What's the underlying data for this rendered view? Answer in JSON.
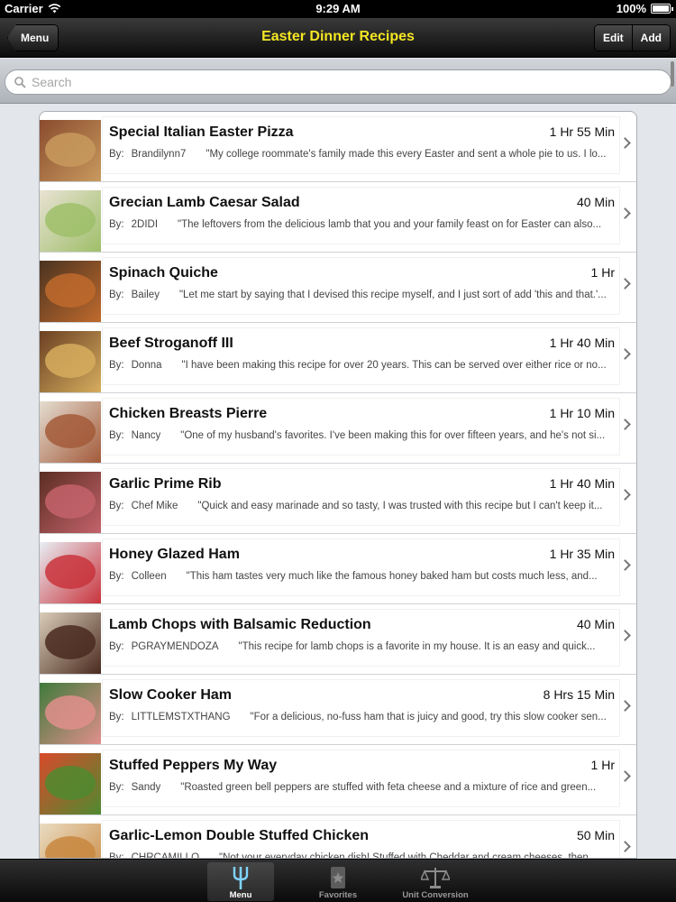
{
  "status": {
    "carrier": "Carrier",
    "time": "9:29 AM",
    "battery": "100%"
  },
  "nav": {
    "back_label": "Menu",
    "title": "Easter Dinner Recipes",
    "edit_label": "Edit",
    "add_label": "Add"
  },
  "search": {
    "placeholder": "Search",
    "value": ""
  },
  "colors": {
    "nav_title": "#f5e623",
    "nav_bg": "#111111",
    "row_border": "#cfd2d6"
  },
  "recipes": [
    {
      "title": "Special Italian Easter Pizza",
      "duration": "1 Hr 55 Min",
      "by": "By:",
      "author": "Brandilynn7",
      "snippet": "\"My college roommate's family made this every Easter and sent a whole pie to us. I lo...",
      "thumb_colors": [
        "#c89a5e",
        "#8a4b2e"
      ]
    },
    {
      "title": "Grecian Lamb Caesar Salad",
      "duration": "40 Min",
      "by": "By:",
      "author": "2DIDI",
      "snippet": "\"The leftovers from the delicious lamb that you and your family feast on for Easter can also...",
      "thumb_colors": [
        "#9fbf6a",
        "#e8e2d3"
      ]
    },
    {
      "title": "Spinach Quiche",
      "duration": "1 Hr",
      "by": "By:",
      "author": "Bailey",
      "snippet": "\"Let me start by saying that I devised this recipe myself, and I just sort of add 'this and that.'...",
      "thumb_colors": [
        "#c06a2d",
        "#4a3320"
      ]
    },
    {
      "title": "Beef Stroganoff III",
      "duration": "1 Hr 40 Min",
      "by": "By:",
      "author": "Donna",
      "snippet": "\"I have been making this recipe for over 20 years. This can be served over either rice or no...",
      "thumb_colors": [
        "#d6ad5e",
        "#6a4023"
      ]
    },
    {
      "title": "Chicken Breasts Pierre",
      "duration": "1 Hr 10 Min",
      "by": "By:",
      "author": "Nancy",
      "snippet": "\"One of my husband's favorites. I've been making this for over fifteen years, and he's not si...",
      "thumb_colors": [
        "#a35a3a",
        "#e4ddd0"
      ]
    },
    {
      "title": "Garlic Prime Rib",
      "duration": "1 Hr 40 Min",
      "by": "By:",
      "author": "Chef Mike",
      "snippet": "\"Quick and easy marinade and so tasty, I was trusted with this recipe but I can't keep it...",
      "thumb_colors": [
        "#c4636b",
        "#5a2d22"
      ]
    },
    {
      "title": "Honey Glazed Ham",
      "duration": "1 Hr 35 Min",
      "by": "By:",
      "author": "Colleen",
      "snippet": "\"This ham tastes very much like the famous honey baked ham but costs much less, and...",
      "thumb_colors": [
        "#c9343c",
        "#e8eef4"
      ]
    },
    {
      "title": "Lamb Chops with Balsamic Reduction",
      "duration": "40 Min",
      "by": "By:",
      "author": "PGRAYMENDOZA",
      "snippet": "\"This recipe for lamb chops is a favorite in my house. It is an easy and quick...",
      "thumb_colors": [
        "#4a2a1e",
        "#d9cdb8"
      ]
    },
    {
      "title": "Slow Cooker Ham",
      "duration": "8 Hrs 15 Min",
      "by": "By:",
      "author": "LITTLEMSTXTHANG",
      "snippet": "\"For a delicious, no-fuss ham that is juicy and good, try this slow cooker sen...",
      "thumb_colors": [
        "#e08f8c",
        "#3f7a3a"
      ]
    },
    {
      "title": "Stuffed Peppers My Way",
      "duration": "1 Hr",
      "by": "By:",
      "author": "Sandy",
      "snippet": "\"Roasted green bell peppers are stuffed with feta cheese and a mixture of rice and green...",
      "thumb_colors": [
        "#4f8a2f",
        "#d84a2c"
      ]
    },
    {
      "title": "Garlic-Lemon Double Stuffed Chicken",
      "duration": "50 Min",
      "by": "By:",
      "author": "CHRCAMILLO",
      "snippet": "\"Not your everyday chicken dish! Stuffed with Cheddar and cream cheeses, then...",
      "thumb_colors": [
        "#c8873f",
        "#eadcc2"
      ]
    }
  ],
  "tabs": [
    {
      "label": "Menu",
      "icon": "fork-icon",
      "active": true
    },
    {
      "label": "Favorites",
      "icon": "star-icon",
      "active": false
    },
    {
      "label": "Unit Conversion",
      "icon": "scale-icon",
      "active": false
    }
  ]
}
